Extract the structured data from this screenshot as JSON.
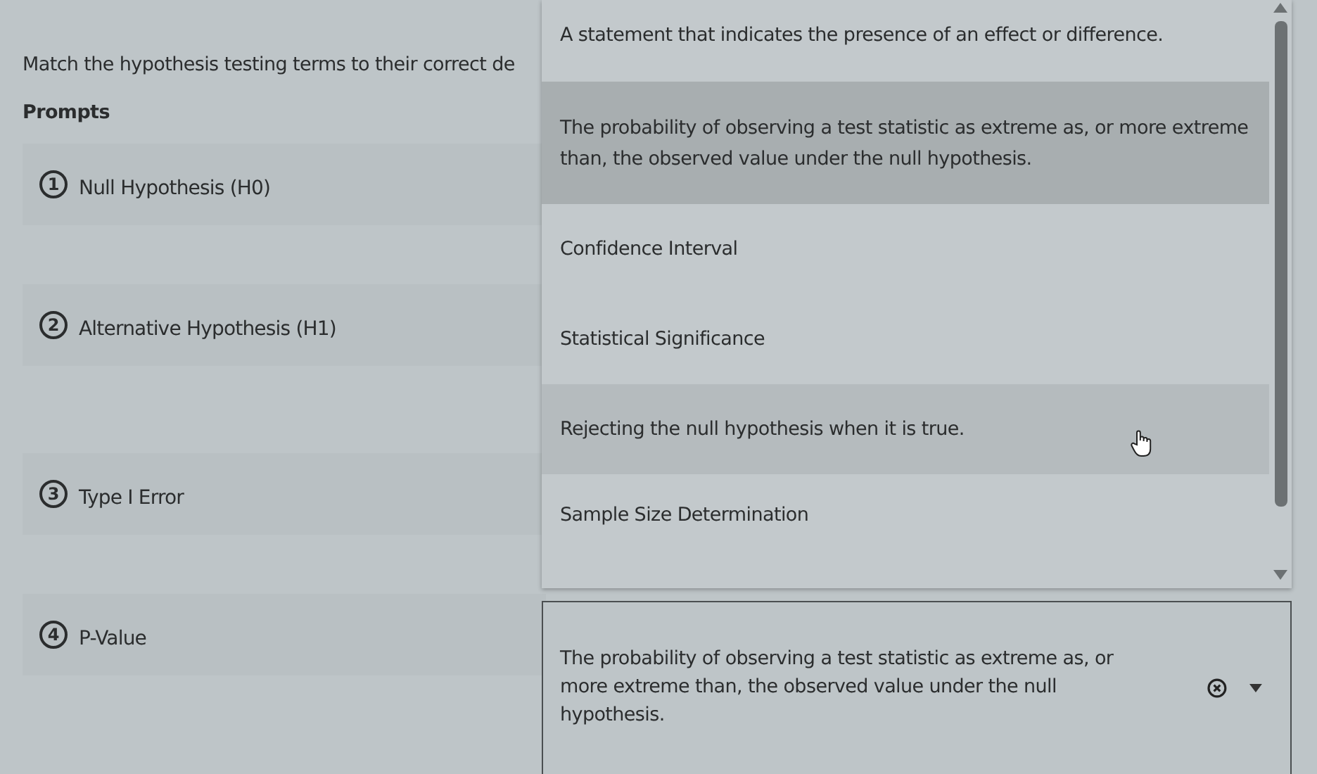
{
  "instruction": "Match the hypothesis testing terms to their correct de",
  "prompts_heading": "Prompts",
  "prompts": [
    {
      "number": "1",
      "label": "Null Hypothesis (H0)"
    },
    {
      "number": "2",
      "label": "Alternative Hypothesis (H1)"
    },
    {
      "number": "3",
      "label": "Type I Error"
    },
    {
      "number": "4",
      "label": "P-Value"
    }
  ],
  "dropdown_options": [
    {
      "text": "A statement that indicates the presence of an effect or difference.",
      "selected": false,
      "hovered": false
    },
    {
      "text": "The probability of observing a test statistic as extreme as, or more extreme than, the observed value under the null hypothesis.",
      "selected": true,
      "hovered": false
    },
    {
      "text": "Confidence Interval",
      "selected": false,
      "hovered": false
    },
    {
      "text": "Statistical Significance",
      "selected": false,
      "hovered": false
    },
    {
      "text": "Rejecting the null hypothesis when it is true.",
      "selected": false,
      "hovered": true
    },
    {
      "text": "Sample Size Determination",
      "selected": false,
      "hovered": false
    }
  ],
  "select_value": "The probability of observing a test statistic as extreme as, or more extreme than, the observed value under the null hypothesis."
}
